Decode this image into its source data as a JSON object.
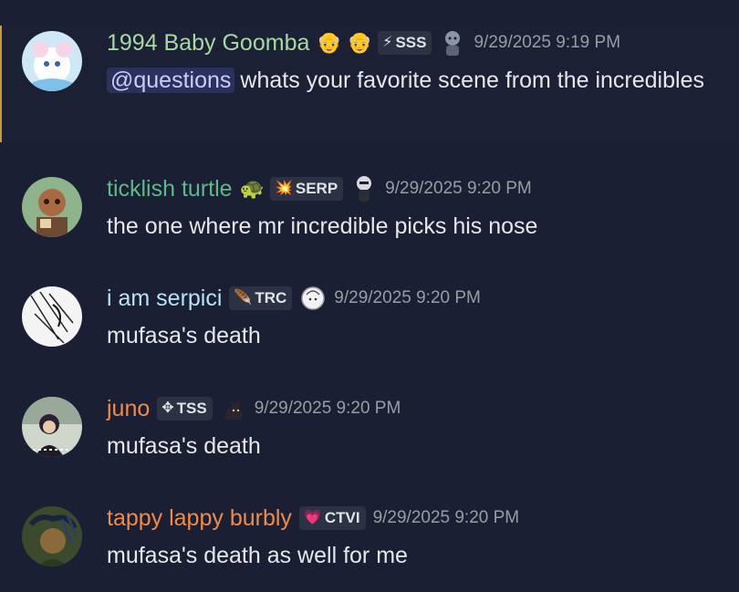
{
  "messages": [
    {
      "username": "1994 Baby Goomba",
      "name_color": "#a7d9a4",
      "emojis": [
        "👴",
        "👴"
      ],
      "tag": {
        "icon": "⚡",
        "label": "SSS"
      },
      "timestamp": "9/29/2025 9:19 PM",
      "mention": "@questions",
      "text": "whats your favorite scene from the incredibles"
    },
    {
      "username": "ticklish turtle",
      "name_color": "#5fb88a",
      "emojis": [
        "🐢"
      ],
      "tag": {
        "icon": "💥",
        "label": "SERP"
      },
      "timestamp": "9/29/2025 9:20 PM",
      "text": "the one where mr incredible picks his nose"
    },
    {
      "username": "i am serpici",
      "name_color": "#b8e2f5",
      "tag": {
        "icon": "🪶",
        "label": "TRC"
      },
      "timestamp": "9/29/2025 9:20 PM",
      "text": "mufasa's death"
    },
    {
      "username": "juno",
      "name_color": "#f08a4b",
      "tag": {
        "icon": "✥",
        "label": "TSS"
      },
      "timestamp": "9/29/2025 9:20 PM",
      "text": "mufasa's death"
    },
    {
      "username": "tappy lappy burbly",
      "name_color": "#f08a4b",
      "tag": {
        "icon": "💗",
        "label": "CTVI"
      },
      "timestamp": "9/29/2025 9:20 PM",
      "text": "mufasa's death as well for me"
    }
  ]
}
